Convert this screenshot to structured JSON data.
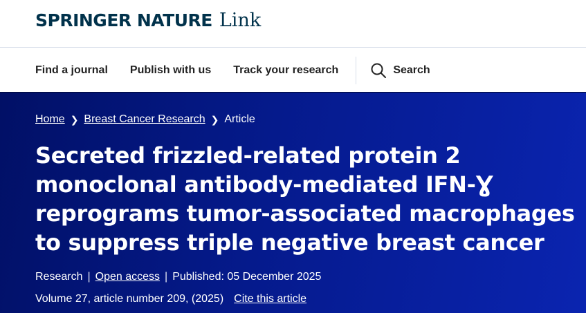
{
  "header": {
    "brand_name": "SPRINGER NATURE",
    "brand_suffix": "Link"
  },
  "nav": {
    "items": [
      {
        "label": "Find a journal"
      },
      {
        "label": "Publish with us"
      },
      {
        "label": "Track your research"
      }
    ],
    "search_label": "Search"
  },
  "breadcrumb": {
    "items": [
      "Home",
      "Breast Cancer Research",
      "Article"
    ],
    "separator": ">"
  },
  "article": {
    "title": "Secreted frizzled-related protein 2 monoclonal antibody-mediated IFN-Ɣ reprograms tumor-associated macrophages to suppress triple negative breast cancer",
    "type": "Research",
    "access": "Open access",
    "published": "Published: 05 December 2025",
    "volume": "Volume 27, article number 209, (2025)",
    "cite": "Cite this article"
  },
  "colors": {
    "brand": "#01324b",
    "hero_background": "#051a8c",
    "hero_text": "#ffffff"
  },
  "icons": {
    "search": "magnifier-icon",
    "breadcrumb_separator": "chevron-right-icon"
  }
}
